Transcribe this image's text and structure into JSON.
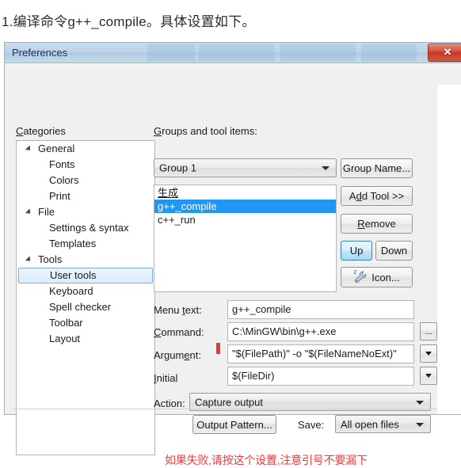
{
  "page": {
    "heading": "1.编译命令g++_compile。具体设置如下。"
  },
  "dialog": {
    "title": "Preferences",
    "close_label": "✕"
  },
  "categories": {
    "label": "Categories",
    "items": [
      {
        "label": "General",
        "level": 0,
        "expander": true,
        "selected": false
      },
      {
        "label": "Fonts",
        "level": 1,
        "expander": false,
        "selected": false
      },
      {
        "label": "Colors",
        "level": 1,
        "expander": false,
        "selected": false
      },
      {
        "label": "Print",
        "level": 1,
        "expander": false,
        "selected": false
      },
      {
        "label": "File",
        "level": 0,
        "expander": true,
        "selected": false
      },
      {
        "label": "Settings & syntax",
        "level": 1,
        "expander": false,
        "selected": false
      },
      {
        "label": "Templates",
        "level": 1,
        "expander": false,
        "selected": false
      },
      {
        "label": "Tools",
        "level": 0,
        "expander": true,
        "selected": false
      },
      {
        "label": "User tools",
        "level": 1,
        "expander": false,
        "selected": true
      },
      {
        "label": "Keyboard",
        "level": 1,
        "expander": false,
        "selected": false
      },
      {
        "label": "Spell checker",
        "level": 1,
        "expander": false,
        "selected": false
      },
      {
        "label": "Toolbar",
        "level": 1,
        "expander": false,
        "selected": false
      },
      {
        "label": "Layout",
        "level": 1,
        "expander": false,
        "selected": false
      }
    ]
  },
  "groups": {
    "label": "Groups and tool items:",
    "selected_group": "Group 1",
    "tools": [
      {
        "label": "生成",
        "selected": false,
        "underlined": true
      },
      {
        "label": "g++_compile",
        "selected": true,
        "underlined": false
      },
      {
        "label": "c++_run",
        "selected": false,
        "underlined": false
      }
    ],
    "buttons": {
      "group_name": "Group Name...",
      "add_tool_pre": "A",
      "add_tool_mnemonic": "d",
      "add_tool_post": "d Tool >>",
      "remove_mnemonic": "R",
      "remove_post": "emove",
      "up": "Up",
      "down": "Down",
      "icon": "Icon...",
      "icon_badge": "2"
    }
  },
  "form": {
    "menu_text": {
      "label_pre": "Menu ",
      "label_mnemonic": "t",
      "label_post": "ext:",
      "value": "g++_compile"
    },
    "command": {
      "label_mnemonic": "C",
      "label_post": "ommand:",
      "value": "C:\\MinGW\\bin\\g++.exe",
      "browse_label": "..."
    },
    "argument": {
      "label_pre": "Argum",
      "label_mnemonic": "e",
      "label_post": "nt:",
      "value": "\"$(FilePath)\" -o \"$(FileNameNoExt)\""
    },
    "initial": {
      "label_mnemonic": "I",
      "label_post": "nitial",
      "value": "$(FileDir)"
    }
  },
  "action": {
    "label": "Action:",
    "value": "Capture output",
    "output_pattern_button": "Output Pattern...",
    "save_label": "Save:",
    "save_value": "All open files"
  },
  "annotation": {
    "text": "如果失败,请按这个设置,注意引号不要漏下"
  },
  "colors": {
    "selection_blue": "#2196f3",
    "annotation_red": "#ef3b3b",
    "marker_red": "#e23b38",
    "dialog_face": "#f0f0f0",
    "titlebar_blue": "#bcd4e8",
    "close_red": "#c23824"
  }
}
